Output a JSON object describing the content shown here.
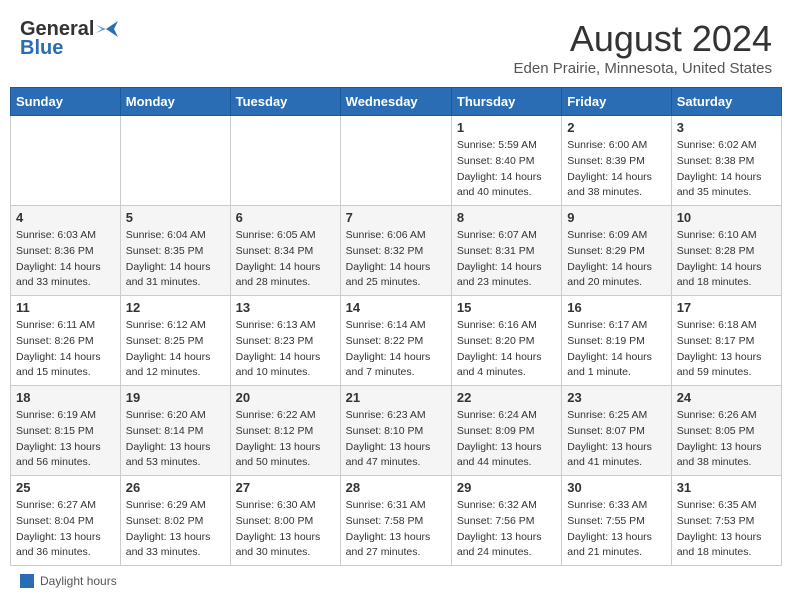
{
  "header": {
    "logo_general": "General",
    "logo_blue": "Blue",
    "month_title": "August 2024",
    "subtitle": "Eden Prairie, Minnesota, United States"
  },
  "calendar": {
    "days_of_week": [
      "Sunday",
      "Monday",
      "Tuesday",
      "Wednesday",
      "Thursday",
      "Friday",
      "Saturday"
    ],
    "weeks": [
      [
        {
          "day": "",
          "info": ""
        },
        {
          "day": "",
          "info": ""
        },
        {
          "day": "",
          "info": ""
        },
        {
          "day": "",
          "info": ""
        },
        {
          "day": "1",
          "info": "Sunrise: 5:59 AM\nSunset: 8:40 PM\nDaylight: 14 hours and 40 minutes."
        },
        {
          "day": "2",
          "info": "Sunrise: 6:00 AM\nSunset: 8:39 PM\nDaylight: 14 hours and 38 minutes."
        },
        {
          "day": "3",
          "info": "Sunrise: 6:02 AM\nSunset: 8:38 PM\nDaylight: 14 hours and 35 minutes."
        }
      ],
      [
        {
          "day": "4",
          "info": "Sunrise: 6:03 AM\nSunset: 8:36 PM\nDaylight: 14 hours and 33 minutes."
        },
        {
          "day": "5",
          "info": "Sunrise: 6:04 AM\nSunset: 8:35 PM\nDaylight: 14 hours and 31 minutes."
        },
        {
          "day": "6",
          "info": "Sunrise: 6:05 AM\nSunset: 8:34 PM\nDaylight: 14 hours and 28 minutes."
        },
        {
          "day": "7",
          "info": "Sunrise: 6:06 AM\nSunset: 8:32 PM\nDaylight: 14 hours and 25 minutes."
        },
        {
          "day": "8",
          "info": "Sunrise: 6:07 AM\nSunset: 8:31 PM\nDaylight: 14 hours and 23 minutes."
        },
        {
          "day": "9",
          "info": "Sunrise: 6:09 AM\nSunset: 8:29 PM\nDaylight: 14 hours and 20 minutes."
        },
        {
          "day": "10",
          "info": "Sunrise: 6:10 AM\nSunset: 8:28 PM\nDaylight: 14 hours and 18 minutes."
        }
      ],
      [
        {
          "day": "11",
          "info": "Sunrise: 6:11 AM\nSunset: 8:26 PM\nDaylight: 14 hours and 15 minutes."
        },
        {
          "day": "12",
          "info": "Sunrise: 6:12 AM\nSunset: 8:25 PM\nDaylight: 14 hours and 12 minutes."
        },
        {
          "day": "13",
          "info": "Sunrise: 6:13 AM\nSunset: 8:23 PM\nDaylight: 14 hours and 10 minutes."
        },
        {
          "day": "14",
          "info": "Sunrise: 6:14 AM\nSunset: 8:22 PM\nDaylight: 14 hours and 7 minutes."
        },
        {
          "day": "15",
          "info": "Sunrise: 6:16 AM\nSunset: 8:20 PM\nDaylight: 14 hours and 4 minutes."
        },
        {
          "day": "16",
          "info": "Sunrise: 6:17 AM\nSunset: 8:19 PM\nDaylight: 14 hours and 1 minute."
        },
        {
          "day": "17",
          "info": "Sunrise: 6:18 AM\nSunset: 8:17 PM\nDaylight: 13 hours and 59 minutes."
        }
      ],
      [
        {
          "day": "18",
          "info": "Sunrise: 6:19 AM\nSunset: 8:15 PM\nDaylight: 13 hours and 56 minutes."
        },
        {
          "day": "19",
          "info": "Sunrise: 6:20 AM\nSunset: 8:14 PM\nDaylight: 13 hours and 53 minutes."
        },
        {
          "day": "20",
          "info": "Sunrise: 6:22 AM\nSunset: 8:12 PM\nDaylight: 13 hours and 50 minutes."
        },
        {
          "day": "21",
          "info": "Sunrise: 6:23 AM\nSunset: 8:10 PM\nDaylight: 13 hours and 47 minutes."
        },
        {
          "day": "22",
          "info": "Sunrise: 6:24 AM\nSunset: 8:09 PM\nDaylight: 13 hours and 44 minutes."
        },
        {
          "day": "23",
          "info": "Sunrise: 6:25 AM\nSunset: 8:07 PM\nDaylight: 13 hours and 41 minutes."
        },
        {
          "day": "24",
          "info": "Sunrise: 6:26 AM\nSunset: 8:05 PM\nDaylight: 13 hours and 38 minutes."
        }
      ],
      [
        {
          "day": "25",
          "info": "Sunrise: 6:27 AM\nSunset: 8:04 PM\nDaylight: 13 hours and 36 minutes."
        },
        {
          "day": "26",
          "info": "Sunrise: 6:29 AM\nSunset: 8:02 PM\nDaylight: 13 hours and 33 minutes."
        },
        {
          "day": "27",
          "info": "Sunrise: 6:30 AM\nSunset: 8:00 PM\nDaylight: 13 hours and 30 minutes."
        },
        {
          "day": "28",
          "info": "Sunrise: 6:31 AM\nSunset: 7:58 PM\nDaylight: 13 hours and 27 minutes."
        },
        {
          "day": "29",
          "info": "Sunrise: 6:32 AM\nSunset: 7:56 PM\nDaylight: 13 hours and 24 minutes."
        },
        {
          "day": "30",
          "info": "Sunrise: 6:33 AM\nSunset: 7:55 PM\nDaylight: 13 hours and 21 minutes."
        },
        {
          "day": "31",
          "info": "Sunrise: 6:35 AM\nSunset: 7:53 PM\nDaylight: 13 hours and 18 minutes."
        }
      ]
    ]
  },
  "legend": {
    "label": "Daylight hours"
  }
}
